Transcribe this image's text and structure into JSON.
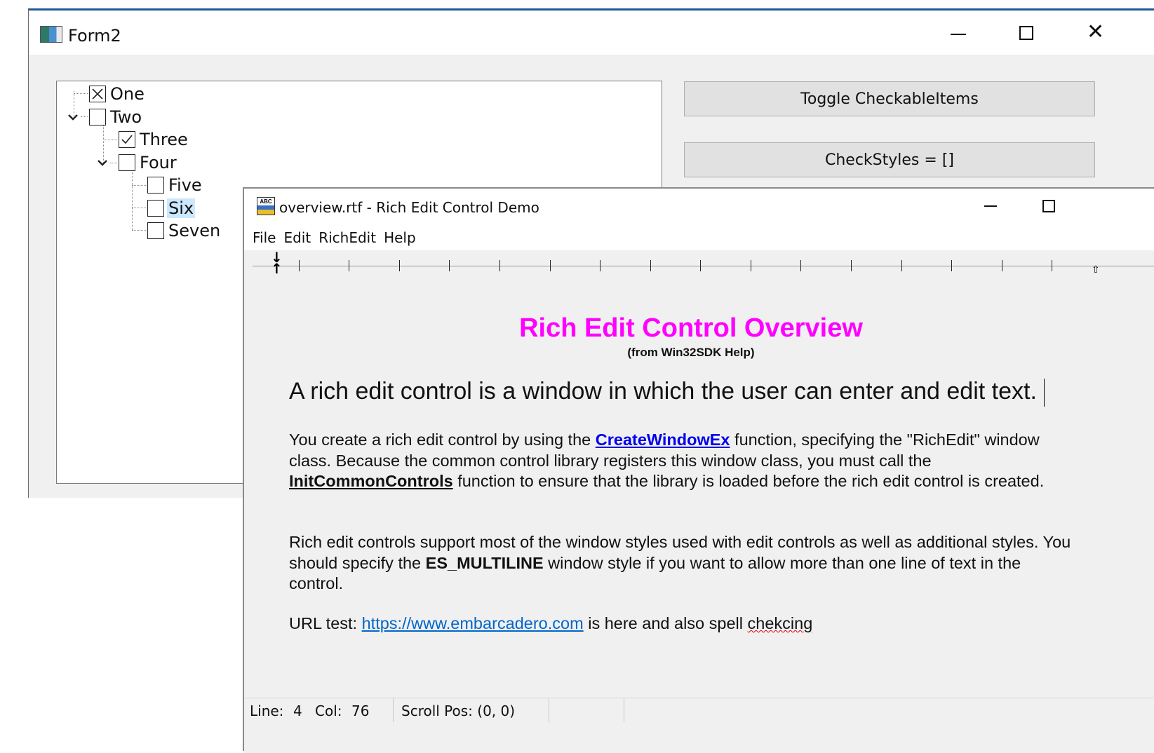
{
  "form2": {
    "title": "Form2",
    "tree": [
      {
        "label": "One",
        "state": "crossed"
      },
      {
        "label": "Two",
        "state": "unchecked"
      },
      {
        "label": "Three",
        "state": "checked"
      },
      {
        "label": "Four",
        "state": "unchecked"
      },
      {
        "label": "Five",
        "state": "unchecked"
      },
      {
        "label": "Six",
        "state": "unchecked",
        "selected": true
      },
      {
        "label": "Seven",
        "state": "unchecked"
      }
    ],
    "buttons": {
      "toggle": "Toggle CheckableItems",
      "checkstyles": "CheckStyles = []"
    },
    "window_controls": {
      "minimize_icon": "minimize-icon",
      "maximize_icon": "maximize-icon",
      "close_icon": "close-icon"
    }
  },
  "richedit": {
    "title": "overview.rtf - Rich Edit Control Demo",
    "menu": [
      "File",
      "Edit",
      "RichEdit",
      "Help"
    ],
    "doc": {
      "heading": "Rich Edit Control Overview",
      "subheading": "(from Win32SDK Help)",
      "lead": "A rich edit control is a window in which the user can enter and edit text.",
      "p1": {
        "t1": "You create a rich edit control by using the ",
        "link1": "CreateWindowEx",
        "t2": " function, specifying the \"RichEdit\" window class. Because the common control library registers this window class, you must call the ",
        "link2": "InitCommonControls",
        "t3": " function to ensure that the library is loaded before the rich edit control is created."
      },
      "p2": {
        "t1": "Rich edit controls support most of the window styles used with edit controls as well as additional styles. You should specify the ",
        "bold": "ES_MULTILINE",
        "t2": " window style if you want to allow more than one line of text in the control."
      },
      "p3": {
        "t1": "URL test: ",
        "url": "https://www.embarcadero.com",
        "t2": " is here and also spell ",
        "misspelled": "chekcing"
      }
    },
    "status": {
      "line_label": "Line:",
      "line_value": "4",
      "col_label": "Col:",
      "col_value": "76",
      "scroll": "Scroll Pos: (0, 0)"
    },
    "colors": {
      "heading": "#ff00ff",
      "link": "#0000ee",
      "url": "#0066cc"
    }
  }
}
